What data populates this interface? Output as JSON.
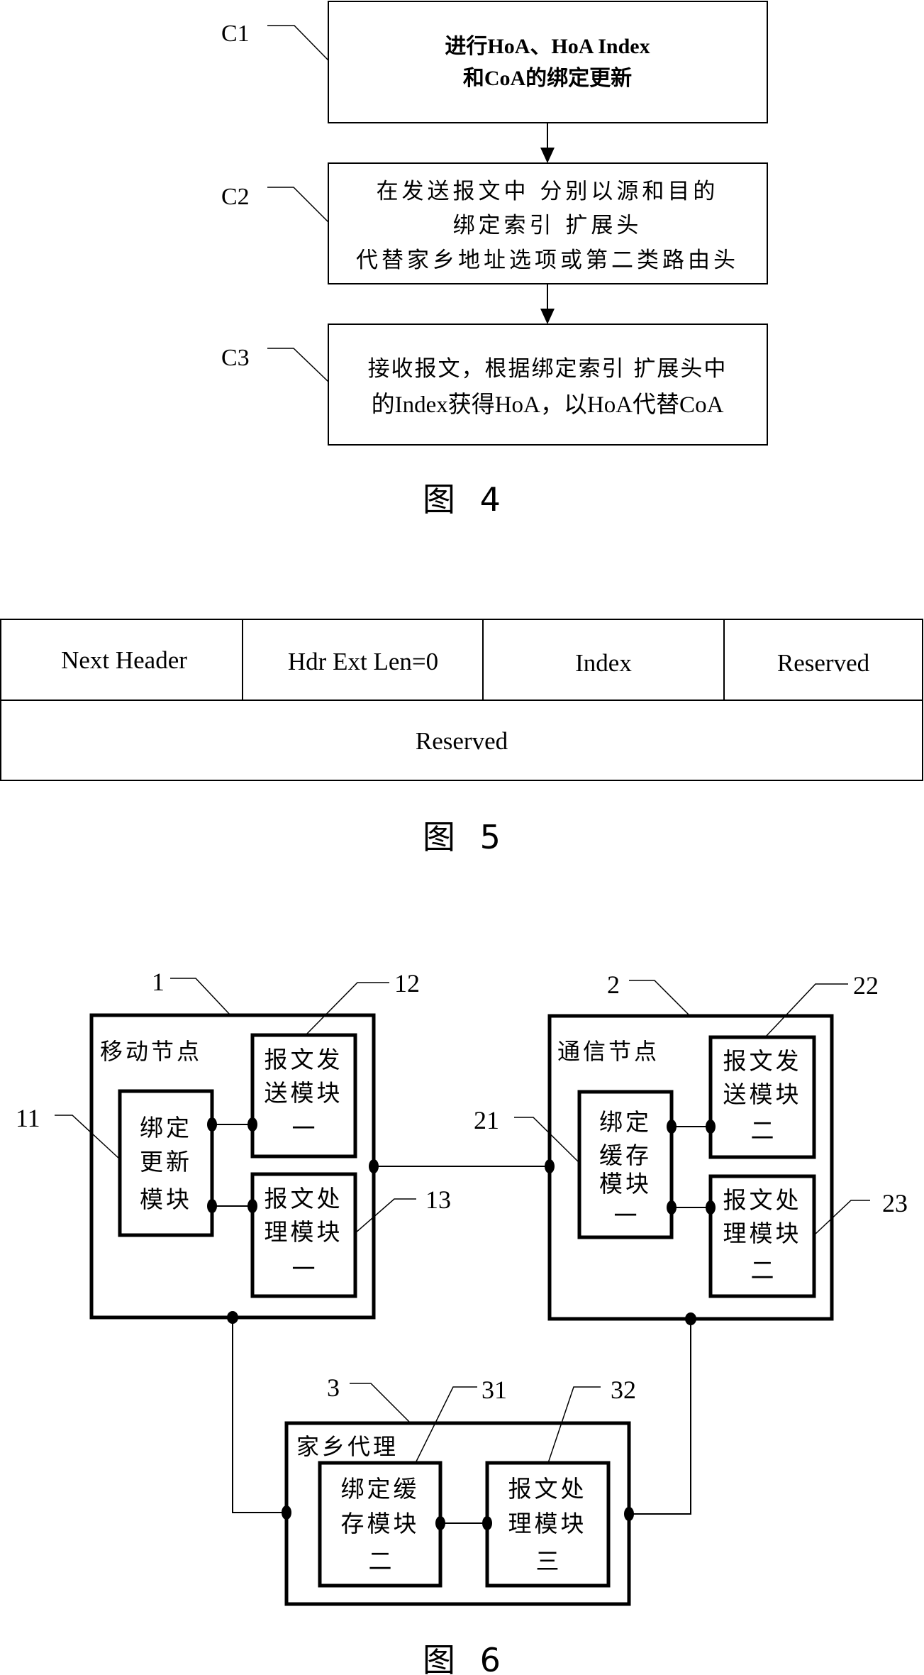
{
  "figure4": {
    "caption": "图 4",
    "steps": [
      {
        "label": "C1",
        "lines": [
          "进行HoA、HoA Index",
          "和CoA的绑定更新"
        ]
      },
      {
        "label": "C2",
        "lines": [
          "在发送报文中 分别以源和目的",
          "绑定索引 扩展头",
          "代替家乡地址选项或第二类路由头"
        ]
      },
      {
        "label": "C3",
        "lines": [
          "接收报文，根据绑定索引 扩展头中",
          "的Index获得HoA，以HoA代替CoA"
        ]
      }
    ]
  },
  "figure5": {
    "caption": "图 5",
    "row1": [
      "Next Header",
      "Hdr Ext Len=0",
      "Index",
      "Reserved"
    ],
    "row2": [
      "Reserved"
    ]
  },
  "figure6": {
    "caption": "图 6",
    "mobile_node": {
      "ref": "1",
      "title": "移动节点",
      "modules": [
        {
          "ref": "11",
          "lines": [
            "绑定",
            "更新",
            "模块"
          ]
        },
        {
          "ref": "12",
          "lines": [
            "报文发",
            "送模块",
            "一"
          ]
        },
        {
          "ref": "13",
          "lines": [
            "报文处",
            "理模块",
            "一"
          ]
        }
      ]
    },
    "correspondent_node": {
      "ref": "2",
      "title": "通信节点",
      "modules": [
        {
          "ref": "21",
          "lines": [
            "绑定",
            "缓存",
            "模块",
            "一"
          ]
        },
        {
          "ref": "22",
          "lines": [
            "报文发",
            "送模块",
            "二"
          ]
        },
        {
          "ref": "23",
          "lines": [
            "报文处",
            "理模块",
            "二"
          ]
        }
      ]
    },
    "home_agent": {
      "ref": "3",
      "title": "家乡代理",
      "modules": [
        {
          "ref": "31",
          "lines": [
            "绑定缓",
            "存模块",
            "二"
          ]
        },
        {
          "ref": "32",
          "lines": [
            "报文处",
            "理模块",
            "三"
          ]
        }
      ]
    }
  }
}
